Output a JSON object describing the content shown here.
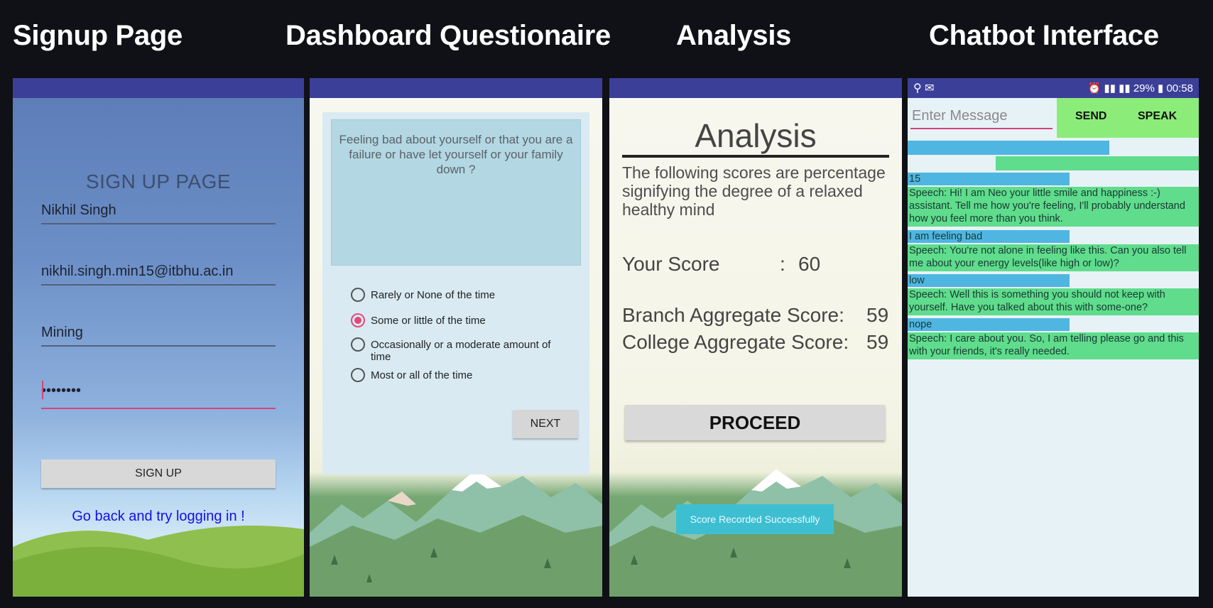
{
  "headings": {
    "signup": "Signup Page",
    "questionnaire": "Dashboard Questionaire",
    "analysis": "Analysis",
    "chatbot": "Chatbot Interface"
  },
  "signup": {
    "title": "SIGN UP PAGE",
    "name_value": "Nikhil Singh",
    "email_value": "nikhil.singh.min15@itbhu.ac.in",
    "branch_value": "Mining",
    "password_value": "••••••••",
    "signup_button": "SIGN UP",
    "login_link": "Go back and try logging in !"
  },
  "questionnaire": {
    "question": "Feeling bad about yourself or that you are a failure or have let yourself or your family down ?",
    "options": [
      "Rarely or None of the time",
      "Some or little of the time",
      "Occasionally or a moderate amount of time",
      "Most or all of the time"
    ],
    "selected_option": 1,
    "next_button": "NEXT"
  },
  "analysis": {
    "title": "Analysis",
    "description": "The following scores are percentage signifying the degree of a relaxed healthy mind",
    "your_score_label": "Your Score",
    "your_score_sep": ":",
    "your_score_value": "60",
    "branch_label": "Branch Aggregate Score:",
    "branch_value": "59",
    "college_label": "College Aggregate Score:",
    "college_value": "59",
    "proceed_button": "PROCEED",
    "toast": "Score Recorded Successfully"
  },
  "chatbot": {
    "status_left": "⚲ ✉",
    "status_right": "⏰ ▮▮ ▮▮ 29% ▮ 00:58",
    "input_placeholder": "Enter Message",
    "send_button": "SEND",
    "speak_button": "SPEAK",
    "messages": [
      {
        "from": "user",
        "text": "15"
      },
      {
        "from": "bot",
        "text": "Speech: Hi! I am Neo your little smile and happiness :-) assistant. Tell me how you're feeling, I'll probably understand how you feel more than you think."
      },
      {
        "from": "user",
        "text": "I am feeling bad"
      },
      {
        "from": "bot",
        "text": "Speech: You're not alone in feeling like this. Can you also tell me about your energy levels(like high or low)?"
      },
      {
        "from": "user",
        "text": "low"
      },
      {
        "from": "bot",
        "text": "Speech: Well this is something you should not keep with yourself. Have you talked about this with some-one?"
      },
      {
        "from": "user",
        "text": "nope"
      },
      {
        "from": "bot",
        "text": "Speech: I care about you. So, I am telling please go and this with your friends, it's really needed."
      }
    ]
  },
  "colors": {
    "app_bar": "#3b3f98",
    "accent_pink": "#d2447c",
    "link_blue": "#1410e6",
    "chat_user_bar": "#4fb6e2",
    "chat_bot_bar": "#5fdc8c",
    "send_area": "#8cec79",
    "toast": "#3dbfd1"
  }
}
